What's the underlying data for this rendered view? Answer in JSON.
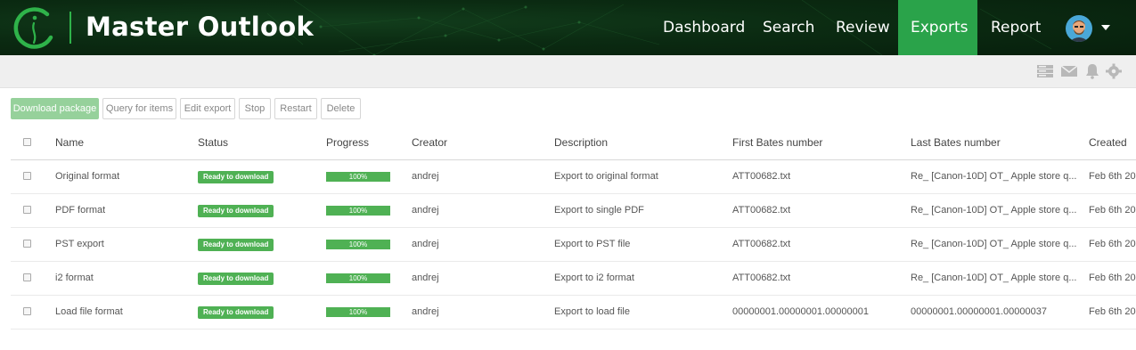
{
  "app": {
    "brand": "Master Outlook",
    "accent": "#2aa34a"
  },
  "nav": {
    "items": [
      {
        "label": "Dashboard",
        "active": false
      },
      {
        "label": "Search",
        "active": false
      },
      {
        "label": "Review",
        "active": false
      },
      {
        "label": "Exports",
        "active": true
      },
      {
        "label": "Report",
        "active": false
      }
    ]
  },
  "toolbar_icons": [
    "server-icon",
    "mail-icon",
    "bell-icon",
    "gear-icon"
  ],
  "actions": {
    "download": "Download package",
    "query": "Query for items",
    "edit": "Edit export",
    "stop": "Stop",
    "restart": "Restart",
    "delete": "Delete"
  },
  "table": {
    "columns": [
      "Name",
      "Status",
      "Progress",
      "Creator",
      "Description",
      "First Bates number",
      "Last Bates number",
      "Created"
    ],
    "rows": [
      {
        "name": "Original format",
        "status": "Ready to download",
        "progress": 100,
        "progress_label": "100%",
        "creator": "andrej",
        "description": "Export to original format",
        "first_bates": "ATT00682.txt",
        "last_bates": "Re_ [Canon-10D] OT_ Apple store q...",
        "created": "Feb 6th 20"
      },
      {
        "name": "PDF format",
        "status": "Ready to download",
        "progress": 100,
        "progress_label": "100%",
        "creator": "andrej",
        "description": "Export to single PDF",
        "first_bates": "ATT00682.txt",
        "last_bates": "Re_ [Canon-10D] OT_ Apple store q...",
        "created": "Feb 6th 20"
      },
      {
        "name": "PST export",
        "status": "Ready to download",
        "progress": 100,
        "progress_label": "100%",
        "creator": "andrej",
        "description": "Export to PST file",
        "first_bates": "ATT00682.txt",
        "last_bates": "Re_ [Canon-10D] OT_ Apple store q...",
        "created": "Feb 6th 20"
      },
      {
        "name": "i2 format",
        "status": "Ready to download",
        "progress": 100,
        "progress_label": "100%",
        "creator": "andrej",
        "description": "Export to i2 format",
        "first_bates": "ATT00682.txt",
        "last_bates": "Re_ [Canon-10D] OT_ Apple store q...",
        "created": "Feb 6th 20"
      },
      {
        "name": "Load file format",
        "status": "Ready to download",
        "progress": 100,
        "progress_label": "100%",
        "creator": "andrej",
        "description": "Export to load file",
        "first_bates": "00000001.00000001.00000001",
        "last_bates": "00000001.00000001.00000037",
        "created": "Feb 6th 20"
      }
    ]
  }
}
